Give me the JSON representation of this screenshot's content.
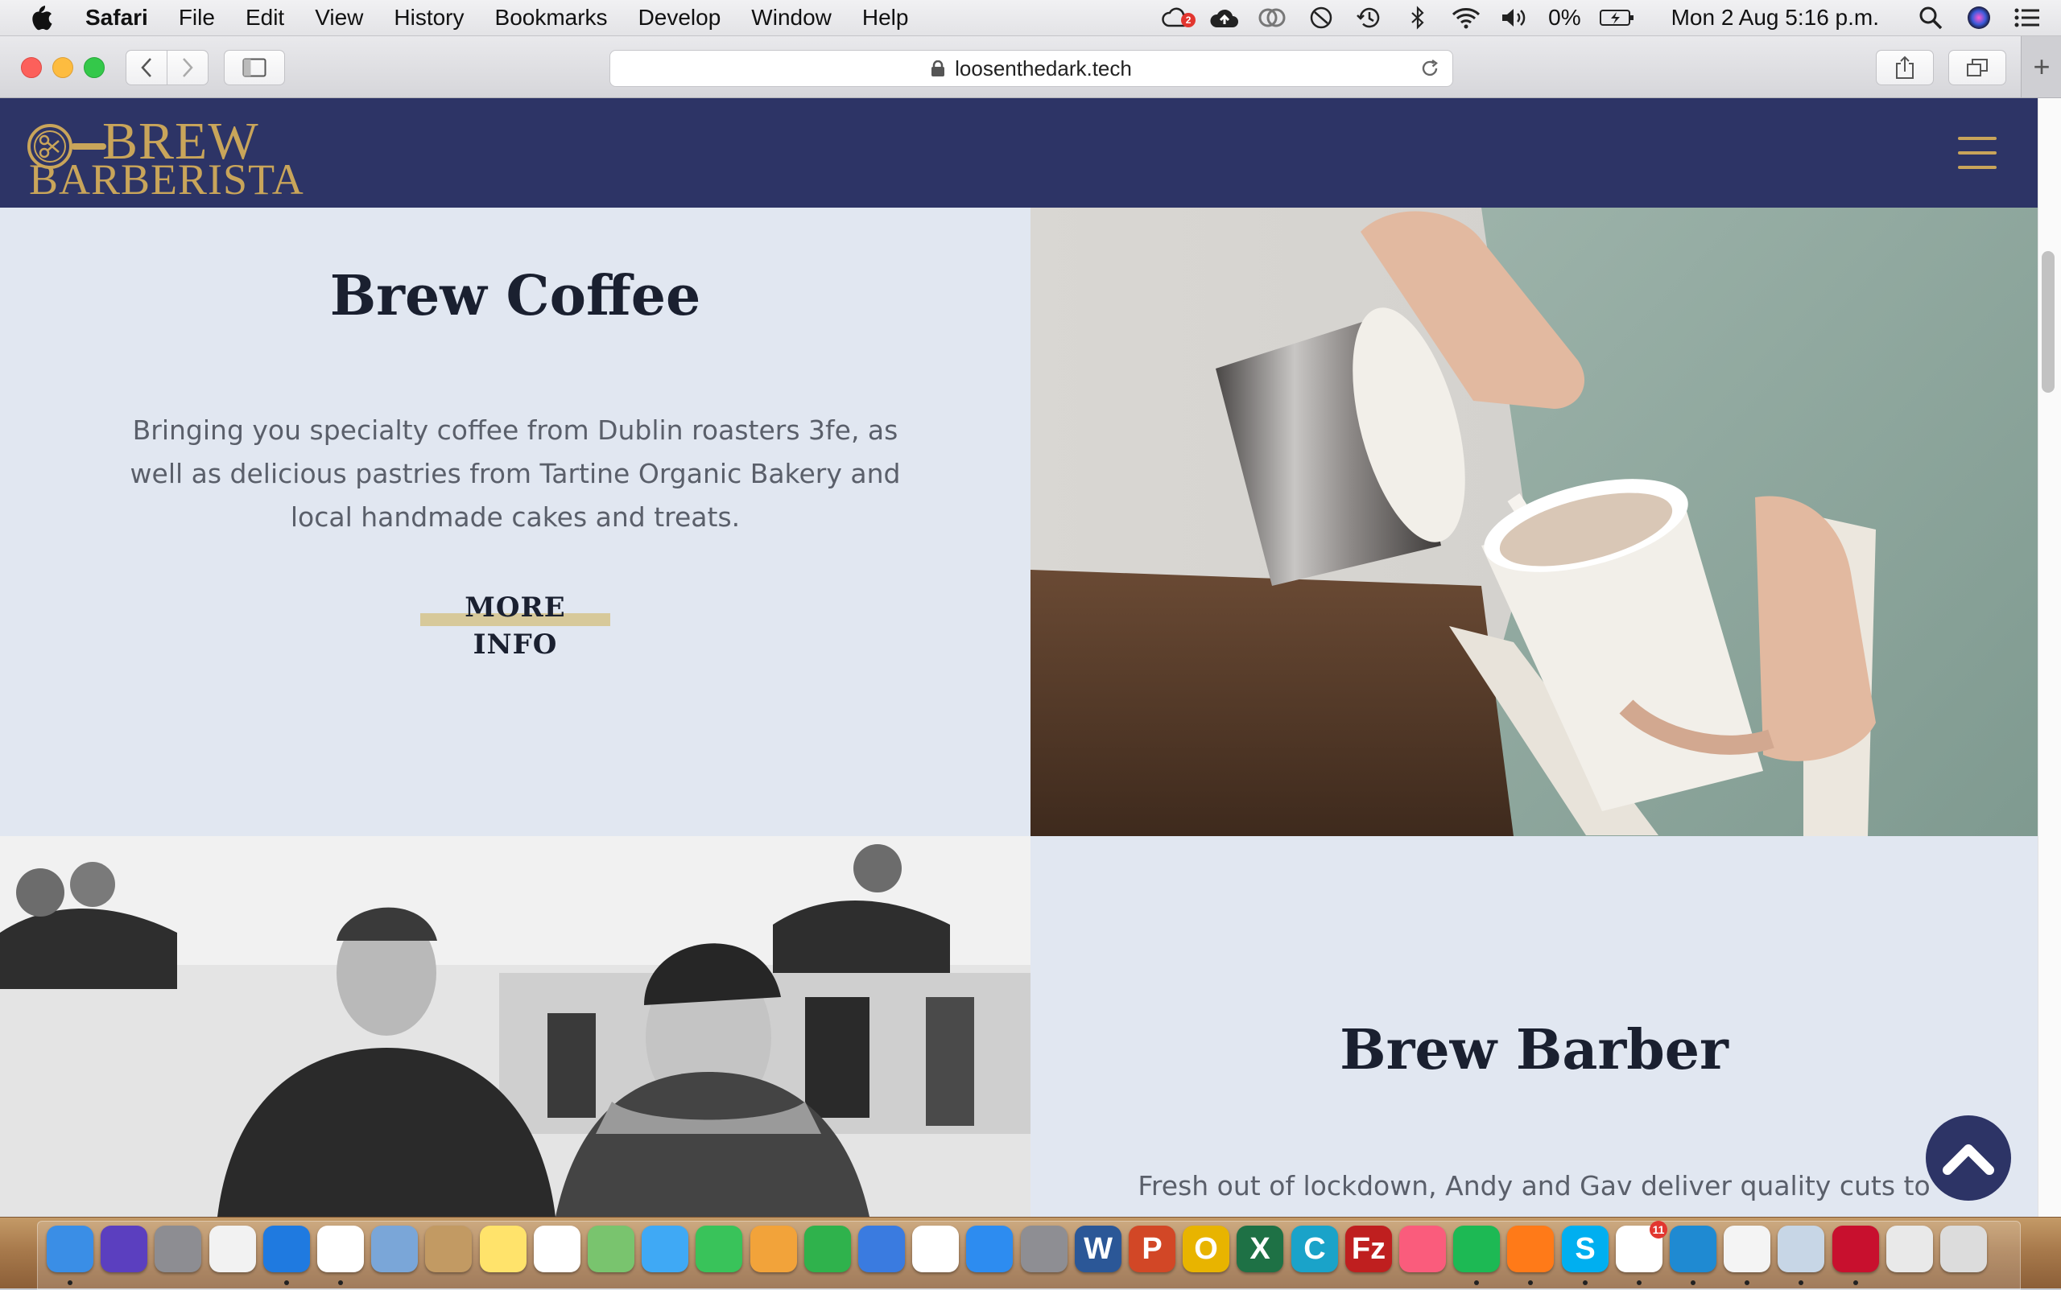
{
  "menubar": {
    "app_name": "Safari",
    "menus": [
      "File",
      "Edit",
      "View",
      "History",
      "Bookmarks",
      "Develop",
      "Window",
      "Help"
    ],
    "cloud_badge": "2",
    "battery_percent": "0%",
    "datetime": "Mon 2 Aug  5:16 p.m."
  },
  "browser": {
    "url": "loosenthedark.tech",
    "new_tab_label": "+"
  },
  "site": {
    "logo_line1": "BREW",
    "logo_line2": "BARBERISTA",
    "brand_color": "#2d3466",
    "accent_color": "#c9a55a",
    "coffee": {
      "title": "Brew Coffee",
      "body": "Bringing you specialty coffee from Dublin roasters 3fe, as well as delicious pastries from Tartine Organic Bakery and local handmade cakes and treats.",
      "cta": "MORE INFO"
    },
    "barber": {
      "title": "Brew Barber",
      "body": "Fresh out of lockdown, Andy and Gav deliver quality cuts to go with your coffee. Get in touch to find out more about booking a cut."
    }
  },
  "dock": {
    "apps": [
      {
        "name": "finder",
        "glyph": "",
        "color": "#3a8ee6",
        "running": true
      },
      {
        "name": "siri",
        "glyph": "",
        "color": "#5b3fbf",
        "running": false
      },
      {
        "name": "launchpad",
        "glyph": "",
        "color": "#8d8d92",
        "running": false
      },
      {
        "name": "launchpad-grid",
        "glyph": "",
        "color": "#f2f2f2",
        "running": false
      },
      {
        "name": "safari",
        "glyph": "",
        "color": "#1f7ae0",
        "running": true
      },
      {
        "name": "chrome",
        "glyph": "",
        "color": "#ffffff",
        "running": true
      },
      {
        "name": "mail-bird",
        "glyph": "",
        "color": "#7aa6d8",
        "running": false
      },
      {
        "name": "contacts",
        "glyph": "",
        "color": "#c29a63",
        "running": false
      },
      {
        "name": "notes",
        "glyph": "",
        "color": "#ffe36b",
        "running": false
      },
      {
        "name": "reminders",
        "glyph": "",
        "color": "#ffffff",
        "running": false
      },
      {
        "name": "maps",
        "glyph": "",
        "color": "#79c46e",
        "running": false
      },
      {
        "name": "messages",
        "glyph": "",
        "color": "#3fa9f5",
        "running": false
      },
      {
        "name": "facetime",
        "glyph": "",
        "color": "#39c35a",
        "running": false
      },
      {
        "name": "pages",
        "glyph": "",
        "color": "#f2a33a",
        "running": false
      },
      {
        "name": "numbers",
        "glyph": "",
        "color": "#2fb24c",
        "running": false
      },
      {
        "name": "keynote",
        "glyph": "",
        "color": "#3a7be0",
        "running": false
      },
      {
        "name": "photos",
        "glyph": "",
        "color": "#ffffff",
        "running": false
      },
      {
        "name": "app-store",
        "glyph": "",
        "color": "#2d8cf0",
        "running": false
      },
      {
        "name": "system-preferences",
        "glyph": "",
        "color": "#8e8e93",
        "running": false
      },
      {
        "name": "word",
        "glyph": "W",
        "color": "#2b5797",
        "running": false
      },
      {
        "name": "powerpoint",
        "glyph": "P",
        "color": "#d24726",
        "running": false
      },
      {
        "name": "outlook",
        "glyph": "O",
        "color": "#e8b400",
        "running": false
      },
      {
        "name": "excel",
        "glyph": "X",
        "color": "#1e7145",
        "running": false
      },
      {
        "name": "cyberduck",
        "glyph": "C",
        "color": "#1aa3c9",
        "running": false
      },
      {
        "name": "filezilla",
        "glyph": "Fz",
        "color": "#bf1f1f",
        "running": false
      },
      {
        "name": "music",
        "glyph": "",
        "color": "#fa5c7c",
        "running": false
      },
      {
        "name": "spotify",
        "glyph": "",
        "color": "#1db954",
        "running": true
      },
      {
        "name": "firefox",
        "glyph": "",
        "color": "#ff7a18",
        "running": true
      },
      {
        "name": "skype",
        "glyph": "S",
        "color": "#00aff0",
        "running": true
      },
      {
        "name": "slack",
        "glyph": "",
        "color": "#ffffff",
        "running": true,
        "badge": "11"
      },
      {
        "name": "vscode",
        "glyph": "",
        "color": "#1f8ad2",
        "running": true
      },
      {
        "name": "textedit",
        "glyph": "",
        "color": "#f4f4f4",
        "running": true
      },
      {
        "name": "preview",
        "glyph": "",
        "color": "#c7d6e6",
        "running": true
      },
      {
        "name": "acrobat",
        "glyph": "",
        "color": "#c8102e",
        "running": true
      },
      {
        "name": "downloads-stack",
        "glyph": "",
        "color": "#e9e9e9",
        "running": false
      },
      {
        "name": "trash",
        "glyph": "",
        "color": "#dcdcdc",
        "running": false
      }
    ]
  }
}
